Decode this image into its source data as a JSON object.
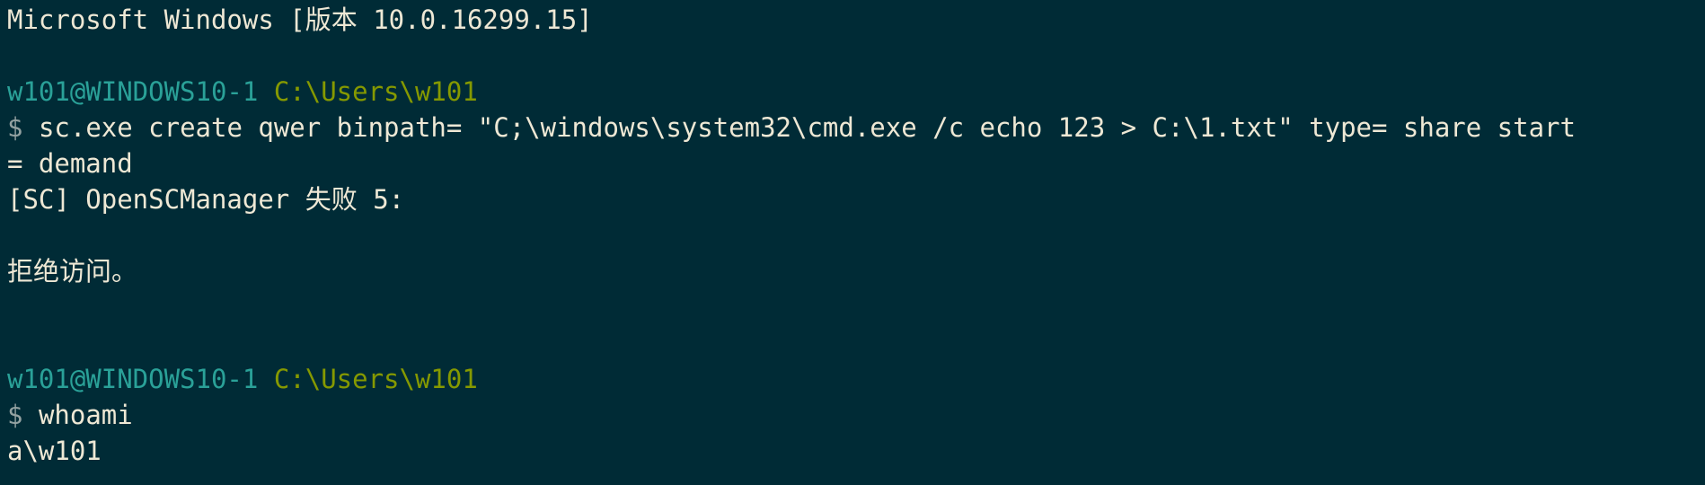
{
  "colors": {
    "background": "#002b36",
    "foreground": "#eee8d5",
    "user_host": "#2aa198",
    "cwd": "#859900",
    "prompt_symbol": "#93a1a1"
  },
  "banner": "Microsoft Windows [版本 10.0.16299.15]",
  "session1": {
    "user_host": "w101@WINDOWS10-1",
    "cwd": "C:\\Users\\w101",
    "prompt_symbol": "$",
    "command_line1": "sc.exe create qwer binpath= \"C;\\windows\\system32\\cmd.exe /c echo 123 > C:\\1.txt\" type= share start",
    "command_line2": "= demand",
    "output_line1": "[SC] OpenSCManager 失败 5:",
    "output_line2": "拒绝访问。"
  },
  "session2": {
    "user_host": "w101@WINDOWS10-1",
    "cwd": "C:\\Users\\w101",
    "prompt_symbol": "$",
    "command": "whoami",
    "output": "a\\w101"
  }
}
